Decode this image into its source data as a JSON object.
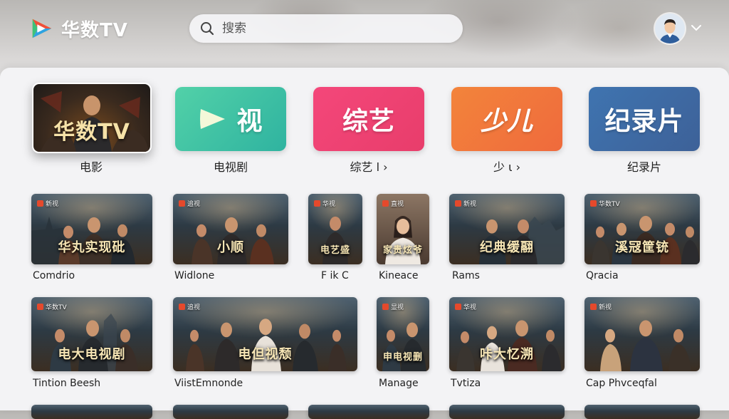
{
  "header": {
    "logo_text": "华数TV",
    "search_placeholder": "搜索"
  },
  "categories": [
    {
      "tile": "华数TV",
      "label": "电影"
    },
    {
      "tile": "视",
      "label": "电视剧"
    },
    {
      "tile": "综艺",
      "label": "综艺 l ›"
    },
    {
      "tile": "少儿",
      "label": "少 ι ›"
    },
    {
      "tile": "纪录片",
      "label": "纪录片"
    }
  ],
  "row1": [
    {
      "title": "华丸实现砒",
      "label": "Comdrio",
      "badge": "新视"
    },
    {
      "title": "小顺",
      "label": "Widlone",
      "badge": "追视"
    },
    {
      "title": "电艺盛",
      "label": "F ik C",
      "badge": "华视"
    },
    {
      "title": "家贵炫爷",
      "label": "Kineace",
      "badge": "直视"
    },
    {
      "title": "纪典缓翮",
      "label": "Rams",
      "badge": "新视"
    },
    {
      "title": "溪冦筐铳",
      "label": "Qracia",
      "badge": "华数TV"
    }
  ],
  "row2": [
    {
      "title": "电大电视剧",
      "label": "Tintion Beesh",
      "badge": "华数TV"
    },
    {
      "title": "电但视颓",
      "label": "ViistEmnonde",
      "badge": "追视"
    },
    {
      "title": "申电视删",
      "label": "Manage",
      "badge": "显视"
    },
    {
      "title": "咔大忆溯",
      "label": "Tvtiza",
      "badge": "华视"
    },
    {
      "title": "",
      "label": "Cap Phvceqfal",
      "badge": "新视"
    }
  ],
  "colors": {
    "tv_tile": "#3dbf9a",
    "variety_tile": "#f0437e",
    "kids_tile": "#f07a3a",
    "documentary_tile": "#3f6aa5"
  }
}
